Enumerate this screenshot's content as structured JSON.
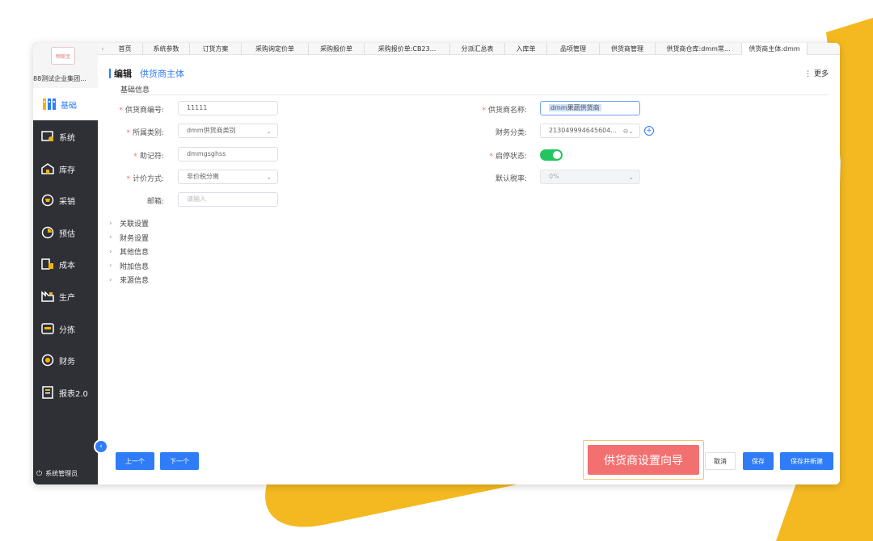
{
  "colors": {
    "accent": "#2f7cf6",
    "decor_yellow": "#f4b921",
    "sidebar_bg": "#2e3036",
    "toggle_on": "#22c55e",
    "callout_red": "#f37070"
  },
  "sidebar": {
    "logo_text": "物联宝",
    "company": "88测试企业集团...",
    "items": [
      {
        "label": "基础",
        "icon": "grid-icon"
      },
      {
        "label": "系统",
        "icon": "settings-window-icon"
      },
      {
        "label": "库存",
        "icon": "warehouse-icon"
      },
      {
        "label": "采销",
        "icon": "cart-icon"
      },
      {
        "label": "预估",
        "icon": "pie-chart-icon"
      },
      {
        "label": "成本",
        "icon": "coins-icon"
      },
      {
        "label": "生产",
        "icon": "factory-icon"
      },
      {
        "label": "分拣",
        "icon": "sort-box-icon"
      },
      {
        "label": "财务",
        "icon": "money-icon"
      },
      {
        "label": "报表2.0",
        "icon": "report-icon"
      }
    ],
    "footer": "系统管理员"
  },
  "tabs": [
    "首页",
    "系统参数",
    "订货方案",
    "采购询定价单",
    "采购报价单",
    "采购报价单:CB23...",
    "分派汇总表",
    "入库单",
    "品项管理",
    "供货商管理",
    "供货商仓库:dmm常...",
    "供货商主体:dmm"
  ],
  "header": {
    "edit_label": "编辑",
    "entity_label": "供货商主体",
    "more_label": "更多"
  },
  "section": {
    "title": "基础信息"
  },
  "form": {
    "supplier_code_label": "供货商编号:",
    "supplier_code_value": "11111",
    "category_label": "所属类别:",
    "category_value": "dmm供货商类别",
    "mnemonic_label": "助记符:",
    "mnemonic_value": "dmmgsghss",
    "pricing_label": "计价方式:",
    "pricing_value": "非价税分离",
    "email_label": "邮箱:",
    "email_placeholder": "请输入",
    "supplier_name_label": "供货商名称:",
    "supplier_name_value": "dmm果蔬供货商",
    "finance_class_label": "财务分类:",
    "finance_class_value": "213049994645604...",
    "status_label": "启停状态:",
    "status_on": true,
    "tax_rate_label": "默认税率:",
    "tax_rate_value": "0%"
  },
  "collapse_sections": [
    "关联设置",
    "财务设置",
    "其他信息",
    "附加信息",
    "来源信息"
  ],
  "footer_buttons": {
    "prev": "上一个",
    "next": "下一个",
    "cancel": "取消",
    "save": "保存",
    "save_new": "保存并新建"
  },
  "callout": {
    "label": "供货商设置向导"
  }
}
